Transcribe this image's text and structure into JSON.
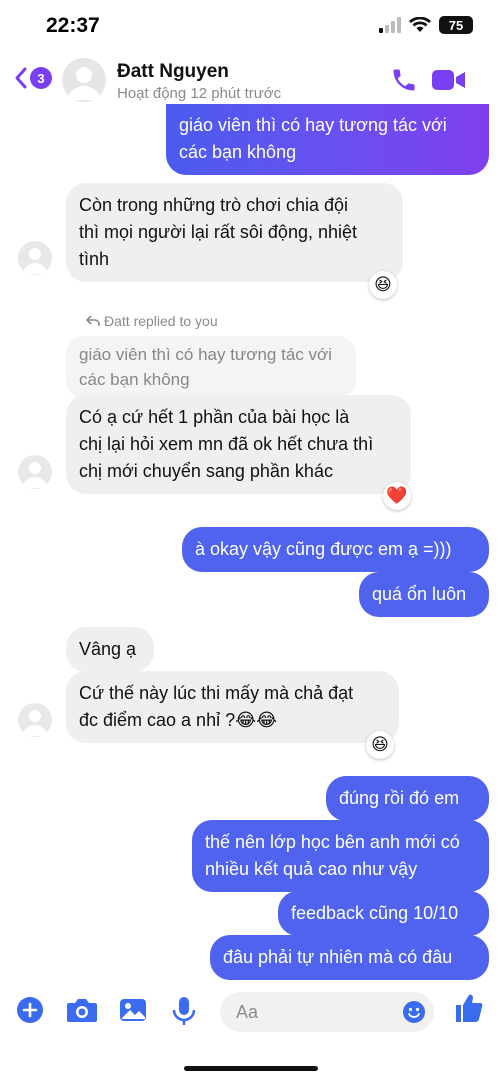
{
  "status_bar": {
    "time": "22:37",
    "battery": "75"
  },
  "header": {
    "back_badge": "3",
    "contact_name": "Đatt Nguyen",
    "contact_status": "Hoạt động 12 phút trước"
  },
  "messages": [
    {
      "text": "giáo viên thì có hay tương tác với\ncác bạn không"
    },
    {
      "text": "Còn trong những trò chơi chia đội\nthì mọi người lại rất sôi động, nhiệt\ntình",
      "reaction": "😆"
    },
    {
      "reply_note": "Đatt replied to you",
      "quoted": "giáo viên thì có hay tương tác với\ncác bạn không"
    },
    {
      "text": "Có ạ cứ hết 1 phần của bài học là\nchị lại hỏi xem mn đã ok hết chưa thì\nchị mới chuyển sang phần khác",
      "reaction": "❤️"
    },
    {
      "text": "à okay vậy cũng được em ạ =)))"
    },
    {
      "text": "quá ổn luôn"
    },
    {
      "text": "Vâng ạ"
    },
    {
      "text": "Cứ thế này lúc thi mấy mà chả đạt\nđc điểm cao a nhỉ ?😂😂",
      "reaction": "😆"
    },
    {
      "text": "đúng rồi đó em"
    },
    {
      "text": "thế nên lớp học bên anh mới có\nnhiều kết quả cao như vậy"
    },
    {
      "text": "feedback cũng 10/10"
    },
    {
      "text": "đâu phải tự nhiên mà có đâu"
    }
  ],
  "composer": {
    "placeholder": "Aa"
  },
  "colors": {
    "accent": "#7a3ff2",
    "outgoing": "#4f63ef",
    "incoming": "#efefef"
  }
}
